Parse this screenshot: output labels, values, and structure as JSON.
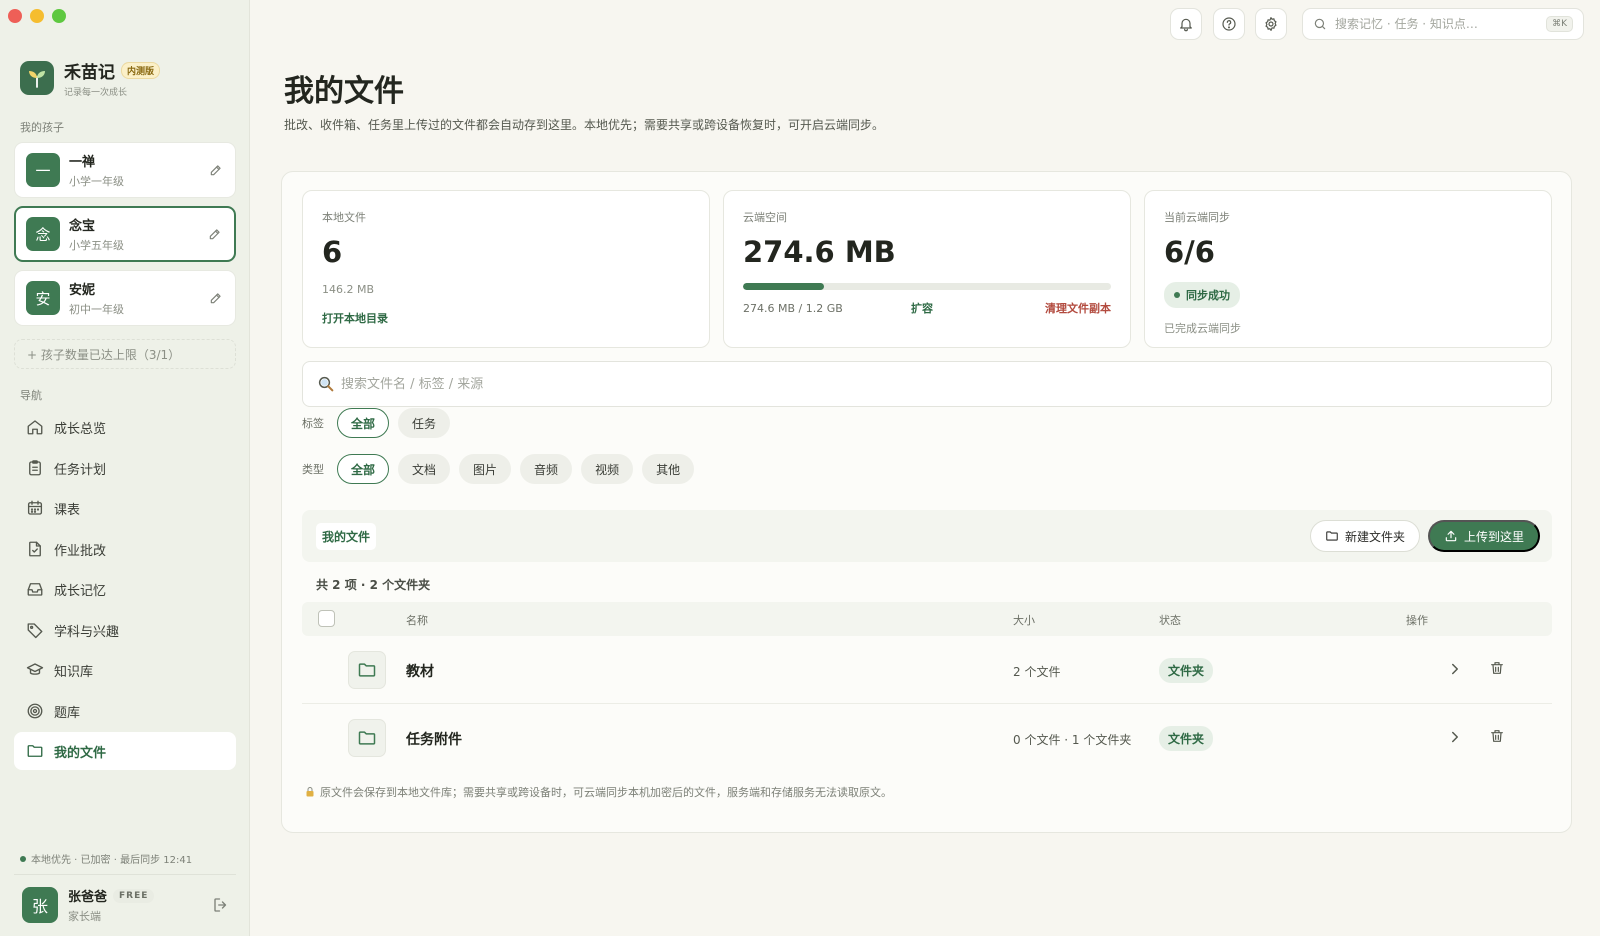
{
  "app": {
    "name": "禾苗记",
    "badge": "内测版",
    "tagline": "记录每一次成长"
  },
  "sidebar": {
    "children_label": "我的孩子",
    "children": [
      {
        "avatar": "一",
        "name": "一禅",
        "grade": "小学一年级"
      },
      {
        "avatar": "念",
        "name": "念宝",
        "grade": "小学五年级"
      },
      {
        "avatar": "安",
        "name": "安妮",
        "grade": "初中一年级"
      }
    ],
    "limit_note": "+ 孩子数量已达上限（3/1）",
    "nav_label": "导航",
    "nav": [
      {
        "label": "成长总览",
        "icon": "home-icon"
      },
      {
        "label": "任务计划",
        "icon": "clipboard-icon"
      },
      {
        "label": "课表",
        "icon": "calendar-icon"
      },
      {
        "label": "作业批改",
        "icon": "file-check-icon"
      },
      {
        "label": "成长记忆",
        "icon": "inbox-icon"
      },
      {
        "label": "学科与兴趣",
        "icon": "tag-icon"
      },
      {
        "label": "知识库",
        "icon": "graduation-cap-icon"
      },
      {
        "label": "题库",
        "icon": "target-icon"
      },
      {
        "label": "我的文件",
        "icon": "folder-icon"
      }
    ],
    "sync_status": "本地优先 · 已加密 · 最后同步 12:41",
    "user": {
      "avatar": "张",
      "name": "张爸爸",
      "plan": "FREE",
      "role": "家长端"
    }
  },
  "topbar": {
    "search_placeholder": "搜索记忆 · 任务 · 知识点…",
    "shortcut": "⌘K"
  },
  "page": {
    "title": "我的文件",
    "description": "批改、收件箱、任务里上传过的文件都会自动存到这里。本地优先；需要共享或跨设备恢复时，可开启云端同步。"
  },
  "stats": {
    "local": {
      "label": "本地文件",
      "value": "6",
      "size": "146.2 MB",
      "link": "打开本地目录"
    },
    "cloud": {
      "label": "云端空间",
      "value": "274.6 MB",
      "usage": "274.6 MB / 1.2 GB",
      "usage_fraction": 0.22,
      "expand": "扩容",
      "clean": "清理文件副本"
    },
    "sync": {
      "label": "当前云端同步",
      "value": "6/6",
      "badge": "同步成功",
      "note": "已完成云端同步"
    }
  },
  "file_search": {
    "placeholder": "搜索文件名 / 标签 / 来源"
  },
  "filters": {
    "tag_label": "标签",
    "tags": [
      "全部",
      "任务"
    ],
    "type_label": "类型",
    "types": [
      "全部",
      "文档",
      "图片",
      "音频",
      "视频",
      "其他"
    ]
  },
  "folder_bar": {
    "crumb": "我的文件",
    "new_folder": "新建文件夹",
    "upload": "上传到这里"
  },
  "listing": {
    "count": "共 2 项 · 2 个文件夹",
    "columns": {
      "name": "名称",
      "size": "大小",
      "status": "状态",
      "actions": "操作"
    },
    "rows": [
      {
        "name": "教材",
        "size": "2 个文件",
        "status": "文件夹"
      },
      {
        "name": "任务附件",
        "size": "0 个文件 · 1 个文件夹",
        "status": "文件夹"
      }
    ]
  },
  "footer_note": "原文件会保存到本地文件库；需要共享或跨设备时，可云端同步本机加密后的文件，服务端和存储服务无法读取原文。"
}
